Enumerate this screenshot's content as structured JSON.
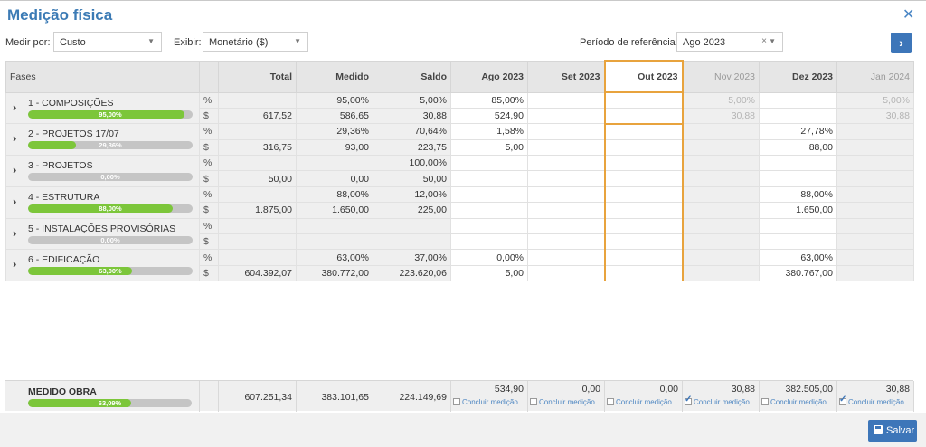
{
  "header": {
    "title": "Medição física"
  },
  "controls": {
    "medir_label": "Medir por:",
    "medir_value": "Custo",
    "exibir_label": "Exibir:",
    "exibir_value": "Monetário ($)",
    "periodo_label": "Período de referência:",
    "periodo_value": "Ago 2023",
    "clear_glyph": "×",
    "caret_glyph": "▼",
    "next_glyph": "›"
  },
  "columns": {
    "fases": "Fases",
    "total": "Total",
    "medido": "Medido",
    "saldo": "Saldo",
    "months": [
      "Ago 2023",
      "Set 2023",
      "Out 2023",
      "Nov 2023",
      "Dez 2023",
      "Jan 2024"
    ]
  },
  "units": {
    "pct": "%",
    "money": "$"
  },
  "phases": [
    {
      "name": "1 - COMPOSIÇÕES",
      "progress": 95,
      "progress_label": "95,00%",
      "pct": {
        "total": "",
        "medido": "95,00%",
        "saldo": "5,00%",
        "months": [
          "85,00%",
          "",
          "",
          "5,00%",
          "",
          "5,00%"
        ]
      },
      "money": {
        "total": "617,52",
        "medido": "586,65",
        "saldo": "30,88",
        "months": [
          "524,90",
          "",
          "",
          "30,88",
          "",
          "30,88"
        ]
      }
    },
    {
      "name": "2 - PROJETOS 17/07",
      "progress": 29.36,
      "progress_label": "29,36%",
      "pct": {
        "total": "",
        "medido": "29,36%",
        "saldo": "70,64%",
        "months": [
          "1,58%",
          "",
          "",
          "",
          "27,78%",
          ""
        ]
      },
      "money": {
        "total": "316,75",
        "medido": "93,00",
        "saldo": "223,75",
        "months": [
          "5,00",
          "",
          "",
          "",
          "88,00",
          ""
        ]
      }
    },
    {
      "name": "3 - PROJETOS",
      "progress": 0,
      "progress_label": "0,00%",
      "pct": {
        "total": "",
        "medido": "",
        "saldo": "100,00%",
        "months": [
          "",
          "",
          "",
          "",
          "",
          ""
        ]
      },
      "money": {
        "total": "50,00",
        "medido": "0,00",
        "saldo": "50,00",
        "months": [
          "",
          "",
          "",
          "",
          "",
          ""
        ]
      }
    },
    {
      "name": "4 - ESTRUTURA",
      "progress": 88,
      "progress_label": "88,00%",
      "pct": {
        "total": "",
        "medido": "88,00%",
        "saldo": "12,00%",
        "months": [
          "",
          "",
          "",
          "",
          "88,00%",
          ""
        ]
      },
      "money": {
        "total": "1.875,00",
        "medido": "1.650,00",
        "saldo": "225,00",
        "months": [
          "",
          "",
          "",
          "",
          "1.650,00",
          ""
        ]
      }
    },
    {
      "name": "5 - INSTALAÇÕES PROVISÓRIAS",
      "progress": 0,
      "progress_label": "0,00%",
      "pct": {
        "total": "",
        "medido": "",
        "saldo": "",
        "months": [
          "",
          "",
          "",
          "",
          "",
          ""
        ]
      },
      "money": {
        "total": "",
        "medido": "",
        "saldo": "",
        "months": [
          "",
          "",
          "",
          "",
          "",
          ""
        ]
      }
    },
    {
      "name": "6 - EDIFICAÇÃO",
      "progress": 63,
      "progress_label": "63,00%",
      "pct": {
        "total": "",
        "medido": "63,00%",
        "saldo": "37,00%",
        "months": [
          "0,00%",
          "",
          "",
          "",
          "63,00%",
          ""
        ]
      },
      "money": {
        "total": "604.392,07",
        "medido": "380.772,00",
        "saldo": "223.620,06",
        "months": [
          "5,00",
          "",
          "",
          "",
          "380.767,00",
          ""
        ]
      }
    }
  ],
  "footer": {
    "name": "MEDIDO OBRA",
    "progress": 63.09,
    "progress_label": "63,09%",
    "total": "607.251,34",
    "medido": "383.101,65",
    "saldo": "224.149,69",
    "months": [
      "534,90",
      "0,00",
      "0,00",
      "30,88",
      "382.505,00",
      "30,88"
    ],
    "concluir_label": "Concluir medição",
    "concluir_checked": [
      false,
      false,
      false,
      true,
      false,
      true
    ]
  },
  "actions": {
    "save_label": "Salvar"
  }
}
